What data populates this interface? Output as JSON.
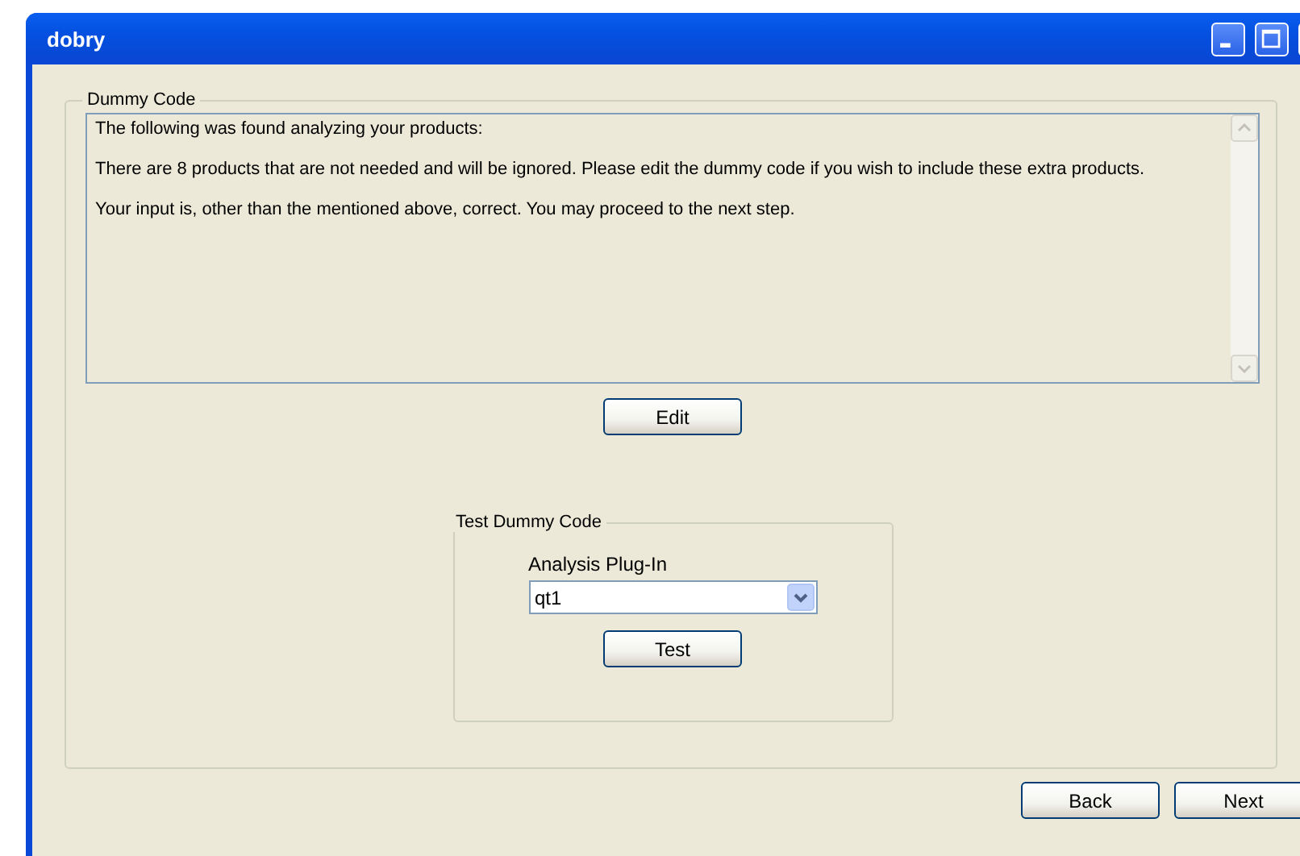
{
  "window": {
    "title": "dobry"
  },
  "dummy_code": {
    "legend": "Dummy Code",
    "message": [
      "The following was found analyzing your products:",
      "There are 8 products that are not needed and will be ignored. Please edit the dummy code if you wish to include these extra products.",
      "Your input is, other than the mentioned above, correct. You may proceed to the next step."
    ],
    "edit_button": "Edit"
  },
  "test_group": {
    "legend": "Test Dummy Code",
    "plugin_label": "Analysis Plug-In",
    "plugin_value": "qt1",
    "test_button": "Test"
  },
  "buttons": [
    "Back",
    "Next"
  ]
}
